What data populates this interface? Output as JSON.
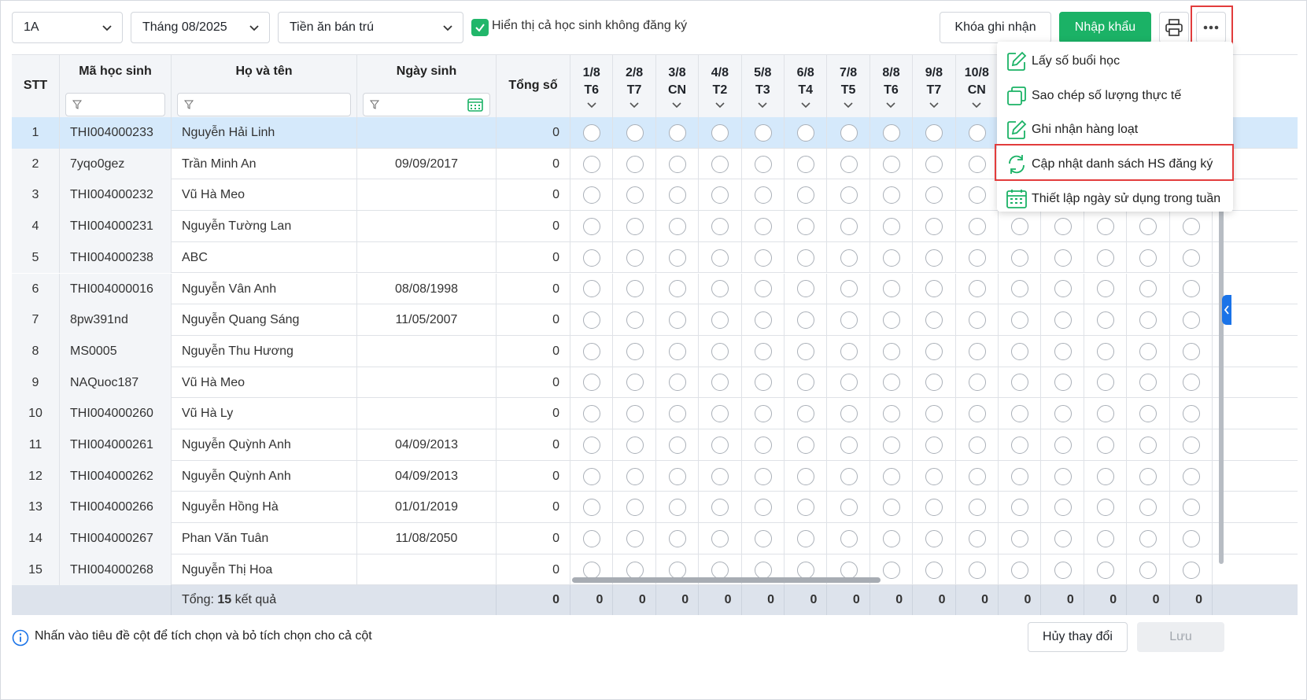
{
  "toolbar": {
    "class_select": "1A",
    "month_select": "Tháng 08/2025",
    "fee_select": "Tiền ăn bán trú",
    "show_unregistered_label": "Hiển thị cả học sinh không đăng ký",
    "show_unregistered_checked": true,
    "lock_button": "Khóa ghi nhận",
    "import_button": "Nhập khẩu"
  },
  "table": {
    "headers": {
      "stt": "STT",
      "student_code": "Mã học sinh",
      "full_name": "Họ và tên",
      "birthdate": "Ngày sinh",
      "total": "Tổng số"
    },
    "days": [
      {
        "date": "1/8",
        "weekday": "T6"
      },
      {
        "date": "2/8",
        "weekday": "T7"
      },
      {
        "date": "3/8",
        "weekday": "CN"
      },
      {
        "date": "4/8",
        "weekday": "T2"
      },
      {
        "date": "5/8",
        "weekday": "T3"
      },
      {
        "date": "6/8",
        "weekday": "T4"
      },
      {
        "date": "7/8",
        "weekday": "T5"
      },
      {
        "date": "8/8",
        "weekday": "T6"
      },
      {
        "date": "9/8",
        "weekday": "T7"
      },
      {
        "date": "10/8",
        "weekday": "CN"
      }
    ],
    "rows": [
      {
        "stt": "1",
        "code": "THI004000233",
        "name": "Nguyễn Hải Linh",
        "birth": "",
        "total": "0",
        "selected": true
      },
      {
        "stt": "2",
        "code": "7yqo0gez",
        "name": "Trần Minh An",
        "birth": "09/09/2017",
        "total": "0"
      },
      {
        "stt": "3",
        "code": "THI004000232",
        "name": "Vũ Hà Meo",
        "birth": "",
        "total": "0"
      },
      {
        "stt": "4",
        "code": "THI004000231",
        "name": "Nguyễn Tường Lan",
        "birth": "",
        "total": "0"
      },
      {
        "stt": "5",
        "code": "THI004000238",
        "name": "ABC",
        "birth": "",
        "total": "0"
      },
      {
        "stt": "6",
        "code": "THI004000016",
        "name": "Nguyễn Vân Anh",
        "birth": "08/08/1998",
        "total": "0"
      },
      {
        "stt": "7",
        "code": "8pw391nd",
        "name": "Nguyễn Quang Sáng",
        "birth": "11/05/2007",
        "total": "0"
      },
      {
        "stt": "8",
        "code": "MS0005",
        "name": "Nguyễn Thu Hương",
        "birth": "",
        "total": "0"
      },
      {
        "stt": "9",
        "code": "NAQuoc187",
        "name": "Vũ Hà Meo",
        "birth": "",
        "total": "0"
      },
      {
        "stt": "10",
        "code": "THI004000260",
        "name": "Vũ Hà Ly",
        "birth": "",
        "total": "0"
      },
      {
        "stt": "11",
        "code": "THI004000261",
        "name": "Nguyễn Quỳnh Anh",
        "birth": "04/09/2013",
        "total": "0"
      },
      {
        "stt": "12",
        "code": "THI004000262",
        "name": "Nguyễn Quỳnh Anh",
        "birth": "04/09/2013",
        "total": "0"
      },
      {
        "stt": "13",
        "code": "THI004000266",
        "name": "Nguyễn Hồng Hà",
        "birth": "01/01/2019",
        "total": "0"
      },
      {
        "stt": "14",
        "code": "THI004000267",
        "name": "Phan Văn Tuân",
        "birth": "11/08/2050",
        "total": "0"
      },
      {
        "stt": "15",
        "code": "THI004000268",
        "name": "Nguyễn Thị Hoa",
        "birth": "",
        "total": "0"
      }
    ],
    "footer": {
      "total_prefix": "Tổng: ",
      "total_count": "15",
      "total_suffix": " kết quả",
      "total_value": "0",
      "day_totals": [
        "0",
        "0",
        "0",
        "0",
        "0",
        "0",
        "0",
        "0",
        "0",
        "0",
        "0",
        "0",
        "0",
        "0",
        "0"
      ]
    }
  },
  "menu": {
    "items": [
      {
        "label": "Lấy số buổi học",
        "icon": "edit-icon"
      },
      {
        "label": "Sao chép số lượng thực tế",
        "icon": "copy-icon"
      },
      {
        "label": "Ghi nhận hàng loạt",
        "icon": "edit-icon"
      },
      {
        "label": "Cập nhật danh sách HS đăng ký",
        "icon": "refresh-icon",
        "highlighted": true
      },
      {
        "label": "Thiết lập ngày sử dụng trong tuần",
        "icon": "calendar-icon"
      }
    ]
  },
  "bottom": {
    "hint": "Nhấn vào tiêu đề cột để tích chọn và bỏ tích chọn cho cả cột",
    "cancel_button": "Hủy thay đổi",
    "save_button": "Lưu"
  },
  "colors": {
    "accent_green": "#1bb266",
    "selected_row": "#d5e9fb",
    "highlight_red": "#e23c3c",
    "link_blue": "#1a73e8"
  }
}
